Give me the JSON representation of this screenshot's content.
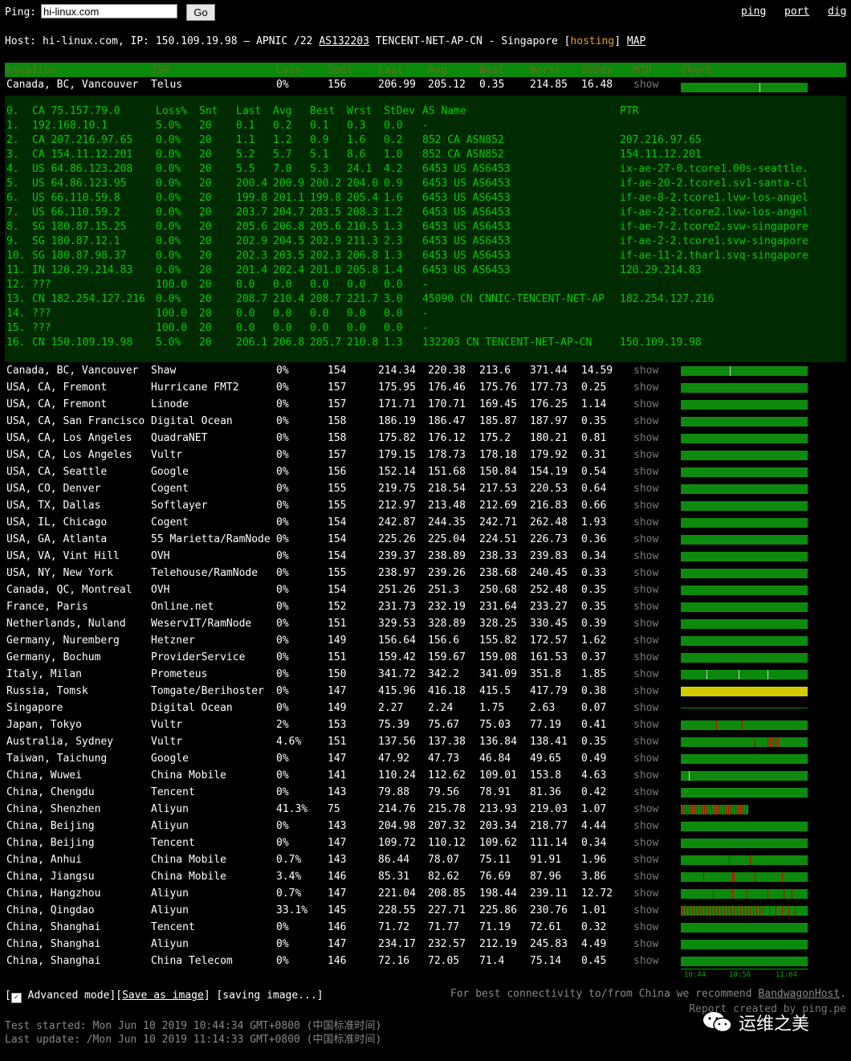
{
  "ping": {
    "label": "Ping:",
    "input_value": "hi-linux.com",
    "go_label": "Go",
    "links": [
      "ping",
      "port",
      "dig"
    ]
  },
  "host": {
    "prefix": "Host: hi-linux.com, IP: 150.109.19.98 – APNIC /22 ",
    "asn_link": "AS132203",
    "mid": " TENCENT-NET-AP-CN - Singapore [",
    "hosting": "hosting",
    "close": "] ",
    "map_link": "MAP"
  },
  "columns": [
    "Location",
    "ISP",
    "Loss",
    "Sent",
    "Last",
    "Avg",
    "Best",
    "Worst",
    "StDev",
    "MTR",
    "Chart"
  ],
  "first_row": [
    "Canada, BC, Vancouver",
    "Telus",
    "0%",
    "156",
    "206.99",
    "205.12",
    "0.35",
    "214.85",
    "16.48",
    "show"
  ],
  "mtr": {
    "header": [
      "0.",
      "CA 75.157.79.0",
      "Loss%",
      "Snt",
      "Last",
      "Avg",
      "Best",
      "Wrst",
      "StDev",
      "AS Name",
      "PTR"
    ],
    "hops": [
      [
        "1.",
        "   192.168.10.1",
        "5.0%",
        "20",
        "0.1",
        "0.2",
        "0.1",
        "0.3",
        "0.0",
        "-",
        ""
      ],
      [
        "2.",
        "CA 207.216.97.65",
        "0.0%",
        "20",
        "1.1",
        "1.2",
        "0.9",
        "1.6",
        "0.2",
        "852   CA ASN852",
        "207.216.97.65"
      ],
      [
        "3.",
        "CA 154.11.12.201",
        "0.0%",
        "20",
        "5.2",
        "5.7",
        "5.1",
        "8.6",
        "1.0",
        "852   CA ASN852",
        "154.11.12.201"
      ],
      [
        "4.",
        "US 64.86.123.208",
        "0.0%",
        "20",
        "5.5",
        "7.0",
        "5.3",
        "24.1",
        "4.2",
        "6453  US AS6453",
        "ix-ae-27-0.tcore1.00s-seattle."
      ],
      [
        "5.",
        "US 64.86.123.95",
        "0.0%",
        "20",
        "200.4",
        "200.9",
        "200.2",
        "204.0",
        "0.9",
        "6453  US AS6453",
        "if-ae-20-2.tcore1.sv1-santa-cl"
      ],
      [
        "6.",
        "US 66.110.59.8",
        "0.0%",
        "20",
        "199.8",
        "201.1",
        "199.8",
        "205.4",
        "1.6",
        "6453  US AS6453",
        "if-ae-8-2.tcore1.lvw-los-angel"
      ],
      [
        "7.",
        "US 66.110.59.2",
        "0.0%",
        "20",
        "203.7",
        "204.7",
        "203.5",
        "208.3",
        "1.2",
        "6453  US AS6453",
        "if-ae-2-2.tcore2.lvw-los-angel"
      ],
      [
        "8.",
        "SG 180.87.15.25",
        "0.0%",
        "20",
        "205.6",
        "206.8",
        "205.6",
        "210.5",
        "1.3",
        "6453  US AS6453",
        "if-ae-7-2.tcore2.svw-singapore"
      ],
      [
        "9.",
        "SG 180.87.12.1",
        "0.0%",
        "20",
        "202.9",
        "204.5",
        "202.9",
        "211.3",
        "2.3",
        "6453  US AS6453",
        "if-ae-2-2.tcore1.svw-singapore"
      ],
      [
        "10.",
        "SG 180.87.98.37",
        "0.0%",
        "20",
        "202.3",
        "203.5",
        "202.3",
        "206.8",
        "1.3",
        "6453  US AS6453",
        "if-ae-11-2.thar1.svq-singapore"
      ],
      [
        "11.",
        "IN 120.29.214.83",
        "0.0%",
        "20",
        "201.4",
        "202.4",
        "201.0",
        "205.8",
        "1.4",
        "6453  US AS6453",
        "120.29.214.83"
      ],
      [
        "12.",
        "   ???",
        "100.0",
        "20",
        "0.0",
        "0.0",
        "0.0",
        "0.0",
        "0.0",
        "-",
        ""
      ],
      [
        "13.",
        "CN 182.254.127.216",
        "0.0%",
        "20",
        "208.7",
        "210.4",
        "208.7",
        "221.7",
        "3.0",
        "45090 CN CNNIC-TENCENT-NET-AP",
        "182.254.127.216"
      ],
      [
        "14.",
        "   ???",
        "100.0",
        "20",
        "0.0",
        "0.0",
        "0.0",
        "0.0",
        "0.0",
        "-",
        ""
      ],
      [
        "15.",
        "   ???",
        "100.0",
        "20",
        "0.0",
        "0.0",
        "0.0",
        "0.0",
        "0.0",
        "-",
        ""
      ],
      [
        "16.",
        "CN 150.109.19.98",
        "5.0%",
        "20",
        "206.1",
        "206.8",
        "205.7",
        "210.8",
        "1.3",
        "132203 CN TENCENT-NET-AP-CN",
        "150.109.19.98"
      ]
    ]
  },
  "rows": [
    [
      "Canada, BC, Vancouver",
      "Shaw",
      "0%",
      "154",
      "214.34",
      "220.38",
      "213.6",
      "371.44",
      "14.59",
      "show"
    ],
    [
      "USA, CA, Fremont",
      "Hurricane FMT2",
      "0%",
      "157",
      "175.95",
      "176.46",
      "175.76",
      "177.73",
      "0.25",
      "show"
    ],
    [
      "USA, CA, Fremont",
      "Linode",
      "0%",
      "157",
      "171.71",
      "170.71",
      "169.45",
      "176.25",
      "1.14",
      "show"
    ],
    [
      "USA, CA, San Francisco",
      "Digital Ocean",
      "0%",
      "158",
      "186.19",
      "186.47",
      "185.87",
      "187.97",
      "0.35",
      "show"
    ],
    [
      "USA, CA, Los Angeles",
      "QuadraNET",
      "0%",
      "158",
      "175.82",
      "176.12",
      "175.2",
      "180.21",
      "0.81",
      "show"
    ],
    [
      "USA, CA, Los Angeles",
      "Vultr",
      "0%",
      "157",
      "179.15",
      "178.73",
      "178.18",
      "179.92",
      "0.31",
      "show"
    ],
    [
      "USA, CA, Seattle",
      "Google",
      "0%",
      "156",
      "152.14",
      "151.68",
      "150.84",
      "154.19",
      "0.54",
      "show"
    ],
    [
      "USA, CO, Denver",
      "Cogent",
      "0%",
      "155",
      "219.75",
      "218.54",
      "217.53",
      "220.53",
      "0.64",
      "show"
    ],
    [
      "USA, TX, Dallas",
      "Softlayer",
      "0%",
      "155",
      "212.97",
      "213.48",
      "212.69",
      "216.83",
      "0.66",
      "show"
    ],
    [
      "USA, IL, Chicago",
      "Cogent",
      "0%",
      "154",
      "242.87",
      "244.35",
      "242.71",
      "262.48",
      "1.93",
      "show"
    ],
    [
      "USA, GA, Atlanta",
      "55 Marietta/RamNode",
      "0%",
      "154",
      "225.26",
      "225.04",
      "224.51",
      "226.73",
      "0.36",
      "show"
    ],
    [
      "USA, VA, Vint Hill",
      "OVH",
      "0%",
      "154",
      "239.37",
      "238.89",
      "238.33",
      "239.83",
      "0.34",
      "show"
    ],
    [
      "USA, NY, New York",
      "Telehouse/RamNode",
      "0%",
      "155",
      "238.97",
      "239.26",
      "238.68",
      "240.45",
      "0.33",
      "show"
    ],
    [
      "Canada, QC, Montreal",
      "OVH",
      "0%",
      "154",
      "251.26",
      "251.3",
      "250.68",
      "252.48",
      "0.35",
      "show"
    ],
    [
      "France, Paris",
      "Online.net",
      "0%",
      "152",
      "231.73",
      "232.19",
      "231.64",
      "233.27",
      "0.35",
      "show"
    ],
    [
      "Netherlands, Nuland",
      "WeservIT/RamNode",
      "0%",
      "151",
      "329.53",
      "328.89",
      "328.25",
      "330.45",
      "0.39",
      "show"
    ],
    [
      "Germany, Nuremberg",
      "Hetzner",
      "0%",
      "149",
      "156.64",
      "156.6",
      "155.82",
      "172.57",
      "1.62",
      "show"
    ],
    [
      "Germany, Bochum",
      "ProviderService",
      "0%",
      "151",
      "159.42",
      "159.67",
      "159.08",
      "161.53",
      "0.37",
      "show"
    ],
    [
      "Italy, Milan",
      "Prometeus",
      "0%",
      "150",
      "341.72",
      "342.2",
      "341.09",
      "351.8",
      "1.85",
      "show"
    ],
    [
      "Russia, Tomsk",
      "Tomgate/Berihoster",
      "0%",
      "147",
      "415.96",
      "416.18",
      "415.5",
      "417.79",
      "0.38",
      "show"
    ],
    [
      "Singapore",
      "Digital Ocean",
      "0%",
      "149",
      "2.27",
      "2.24",
      "1.75",
      "2.63",
      "0.07",
      "show"
    ],
    [
      "Japan, Tokyo",
      "Vultr",
      "2%",
      "153",
      "75.39",
      "75.67",
      "75.03",
      "77.19",
      "0.41",
      "show"
    ],
    [
      "Australia, Sydney",
      "Vultr",
      "4.6%",
      "151",
      "137.56",
      "137.38",
      "136.84",
      "138.41",
      "0.35",
      "show"
    ],
    [
      "Taiwan, Taichung",
      "Google",
      "0%",
      "147",
      "47.92",
      "47.73",
      "46.84",
      "49.65",
      "0.49",
      "show"
    ],
    [
      "China, Wuwei",
      "China Mobile",
      "0%",
      "141",
      "110.24",
      "112.62",
      "109.01",
      "153.8",
      "4.63",
      "show"
    ],
    [
      "China, Chengdu",
      "Tencent",
      "0%",
      "143",
      "79.88",
      "79.56",
      "78.91",
      "81.36",
      "0.42",
      "show"
    ],
    [
      "China, Shenzhen",
      "Aliyun",
      "41.3%",
      "75",
      "214.76",
      "215.78",
      "213.93",
      "219.03",
      "1.07",
      "show"
    ],
    [
      "China, Beijing",
      "Aliyun",
      "0%",
      "143",
      "204.98",
      "207.32",
      "203.34",
      "218.77",
      "4.44",
      "show"
    ],
    [
      "China, Beijing",
      "Tencent",
      "0%",
      "147",
      "109.72",
      "110.12",
      "109.62",
      "111.14",
      "0.34",
      "show"
    ],
    [
      "China, Anhui",
      "China Mobile",
      "0.7%",
      "143",
      "86.44",
      "78.07",
      "75.11",
      "91.91",
      "1.96",
      "show"
    ],
    [
      "China, Jiangsu",
      "China Mobile",
      "3.4%",
      "146",
      "85.31",
      "82.62",
      "76.69",
      "87.96",
      "3.86",
      "show"
    ],
    [
      "China, Hangzhou",
      "Aliyun",
      "0.7%",
      "147",
      "221.04",
      "208.85",
      "198.44",
      "239.11",
      "12.72",
      "show"
    ],
    [
      "China, Qingdao",
      "Aliyun",
      "33.1%",
      "145",
      "228.55",
      "227.71",
      "225.86",
      "230.76",
      "1.01",
      "show"
    ],
    [
      "China, Shanghai",
      "Tencent",
      "0%",
      "146",
      "71.72",
      "71.77",
      "71.19",
      "72.61",
      "0.32",
      "show"
    ],
    [
      "China, Shanghai",
      "Aliyun",
      "0%",
      "147",
      "234.17",
      "232.57",
      "212.19",
      "245.83",
      "4.49",
      "show"
    ],
    [
      "China, Shanghai",
      "China Telecom",
      "0%",
      "146",
      "72.16",
      "72.05",
      "71.4",
      "75.14",
      "0.45",
      "show"
    ]
  ],
  "bar_colors": {
    "ok": "#0d8a0d",
    "warn": "#d4cc00",
    "loss": "#cc0000"
  },
  "axis_labels": [
    "10:44",
    "10:50",
    "11:04"
  ],
  "footer": {
    "adv_open": "[",
    "adv_label": "Advanced mode",
    "adv_close": "][",
    "save_link": "Save as image",
    "saving": "] [saving image...]",
    "recommend_prefix": "For best connectivity to/from China we recommend ",
    "recommend_link": "BandwagonHost",
    "recommend_suffix": ".",
    "report": "Report created by ping.pe",
    "test_started": "Test started: Mon Jun 10 2019 10:44:34 GMT+0800 (中国标准时间)",
    "last_update": "Last update: /Mon Jun 10 2019 11:14:33 GMT+0800 (中国标准时间)"
  },
  "watermark": "运维之美"
}
